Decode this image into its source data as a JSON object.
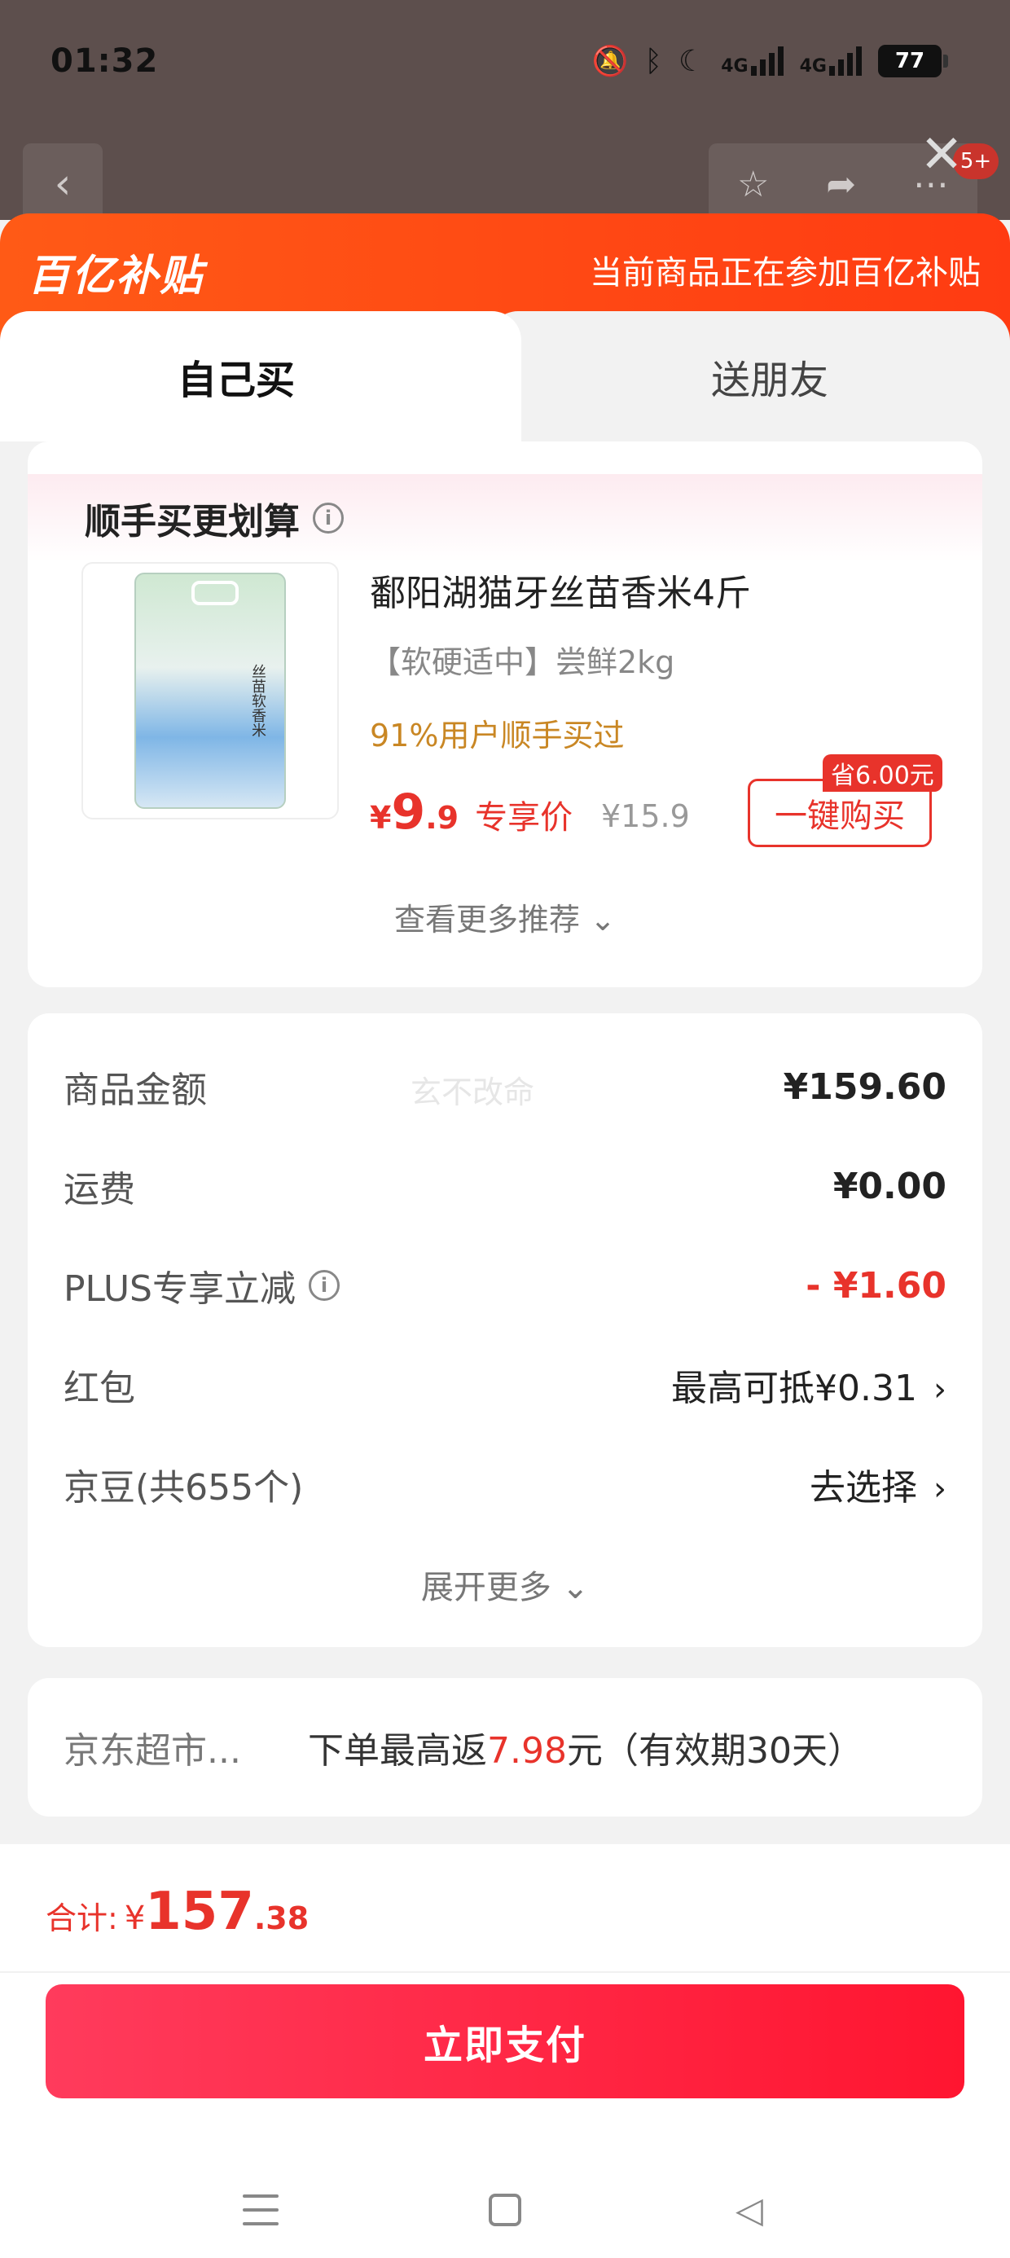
{
  "status": {
    "time": "01:32",
    "network1": "4G",
    "network2": "4G",
    "battery": "77"
  },
  "background": {
    "badge": "5+"
  },
  "header": {
    "brand": "百亿补贴",
    "note": "当前商品正在参加百亿补贴"
  },
  "tabs": {
    "self": "自己买",
    "friend": "送朋友"
  },
  "recommend": {
    "title": "顺手买更划算",
    "product": {
      "name": "鄱阳湖猫牙丝苗香米4斤",
      "spec": "【软硬适中】尝鲜2kg",
      "social": "91%用户顺手买过",
      "price_currency": "¥",
      "price_int": "9",
      "price_dec": ".9",
      "price_tag": "专享价",
      "original_price": "¥15.9",
      "save_badge": "省6.00元",
      "buy_label": "一键购买",
      "bag_text": "丝苗软香米"
    },
    "more": "查看更多推荐"
  },
  "costs": {
    "watermark": "玄不改命",
    "rows": [
      {
        "label": "商品金额",
        "value": "¥159.60"
      },
      {
        "label": "运费",
        "value": "¥0.00"
      },
      {
        "label": "PLUS专享立减",
        "value": "- ¥1.60"
      },
      {
        "label": "红包",
        "value": "最高可抵¥0.31"
      },
      {
        "label": "京豆(共655个)",
        "value": "去选择"
      }
    ],
    "expand": "展开更多"
  },
  "cashback": {
    "store": "京东超市...",
    "prefix": "下单最高返",
    "amount": "7.98",
    "suffix": "元（有效期30天）"
  },
  "footer": {
    "total_label": "合计:",
    "total_currency": "¥",
    "total_int": "157",
    "total_dec": ".38",
    "pay_label": "立即支付"
  },
  "colors": {
    "accent_red": "#e8332b",
    "header_orange": "#ff4a14",
    "social_gold": "#c98724"
  }
}
